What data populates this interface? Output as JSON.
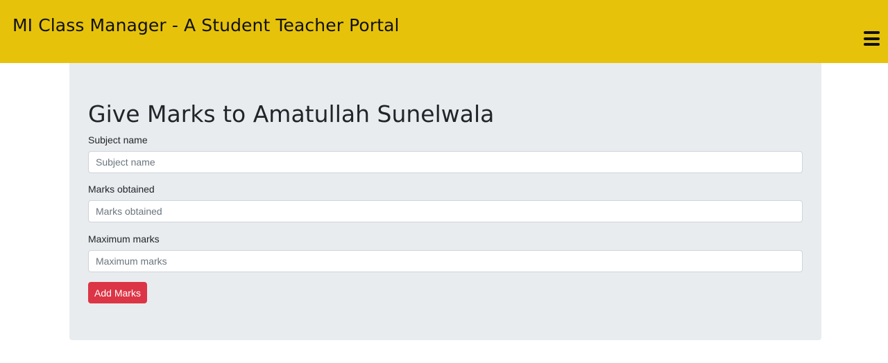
{
  "header": {
    "brand": "MI Class Manager - A Student Teacher Portal",
    "menu_icon": "hamburger-menu-icon"
  },
  "form": {
    "title": "Give Marks to Amatullah Sunelwala",
    "subject": {
      "label": "Subject name",
      "placeholder": "Subject name",
      "value": ""
    },
    "marks_obtained": {
      "label": "Marks obtained",
      "placeholder": "Marks obtained",
      "value": ""
    },
    "maximum_marks": {
      "label": "Maximum marks",
      "placeholder": "Maximum marks",
      "value": ""
    },
    "submit_label": "Add Marks"
  },
  "colors": {
    "navbar": "#e6c20a",
    "panel": "#e9ecef",
    "button": "#dc3545"
  }
}
